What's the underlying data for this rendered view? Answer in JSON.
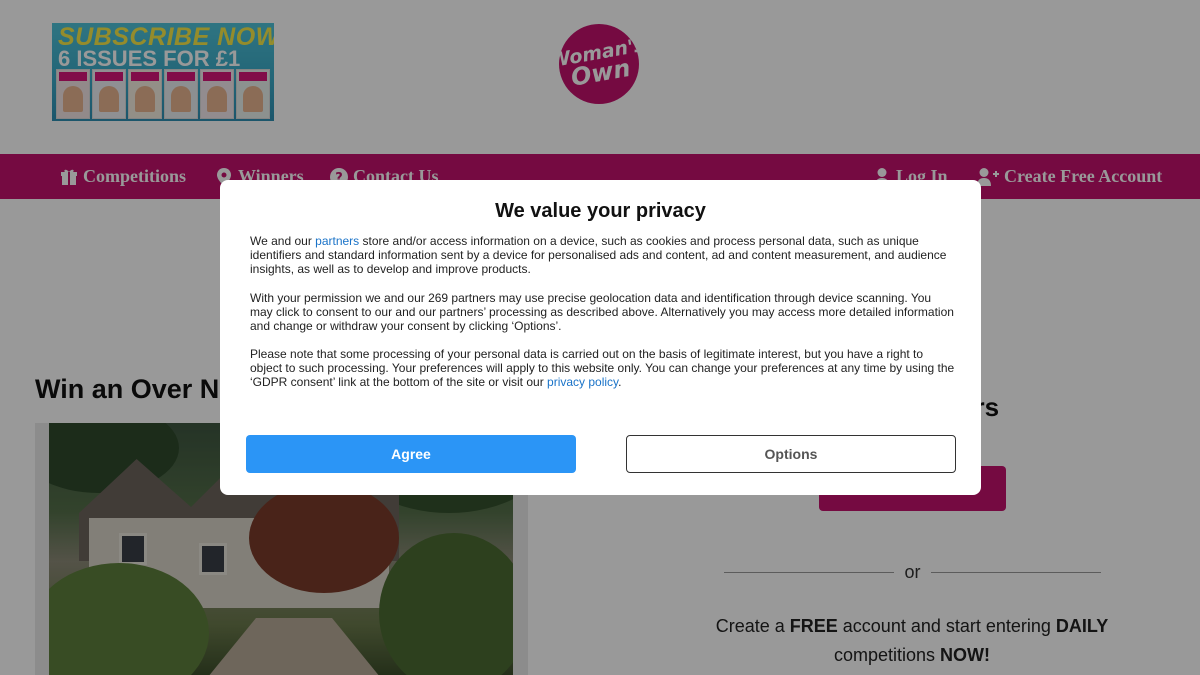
{
  "promo": {
    "line1": "SUBSCRIBE NOW!",
    "line2": "6 ISSUES FOR £1"
  },
  "logo": {
    "text_line1": "Woman's",
    "text_line2": "Own"
  },
  "nav": {
    "left": [
      {
        "label": "Competitions",
        "icon": "gift-icon"
      },
      {
        "label": "Winners",
        "icon": "map-pin-icon"
      },
      {
        "label": "Contact Us",
        "icon": "question-circle-icon"
      }
    ],
    "right": [
      {
        "label": "Log In",
        "icon": "user-icon"
      },
      {
        "label": "Create Free Account",
        "icon": "user-plus-icon"
      }
    ]
  },
  "main": {
    "headline": "Win an Over Ni"
  },
  "sidebar": {
    "title": "ers",
    "or_text": "or",
    "cta": {
      "pre": "Create a ",
      "free": "FREE",
      "mid": " account and start entering ",
      "daily": "DAILY",
      "line2_pre": "competitions ",
      "now": "NOW!"
    }
  },
  "modal": {
    "title": "We value your privacy",
    "p1_pre": "We and our ",
    "p1_link": "partners",
    "p1_post": " store and/or access information on a device, such as cookies and process personal data, such as unique identifiers and standard information sent by a device for personalised ads and content, ad and content measurement, and audience insights, as well as to develop and improve products.",
    "p2": "With your permission we and our 269 partners may use precise geolocation data and identification through device scanning. You may click to consent to our and our partners’ processing as described above. Alternatively you may access more detailed information and change or withdraw your consent by clicking ‘Options’.",
    "p3_pre": "Please note that some processing of your personal data is carried out on the basis of legitimate interest, but you have a right to object to such processing. Your preferences will apply to this website only. You can change your preferences at any time by using the ‘GDPR consent’ link at the bottom of the site or visit our ",
    "p3_link": "privacy policy",
    "p3_post": ".",
    "agree_label": "Agree",
    "options_label": "Options"
  },
  "colors": {
    "brand": "#c4126d",
    "agree_button": "#2b95f6",
    "link": "#1a73c8"
  }
}
